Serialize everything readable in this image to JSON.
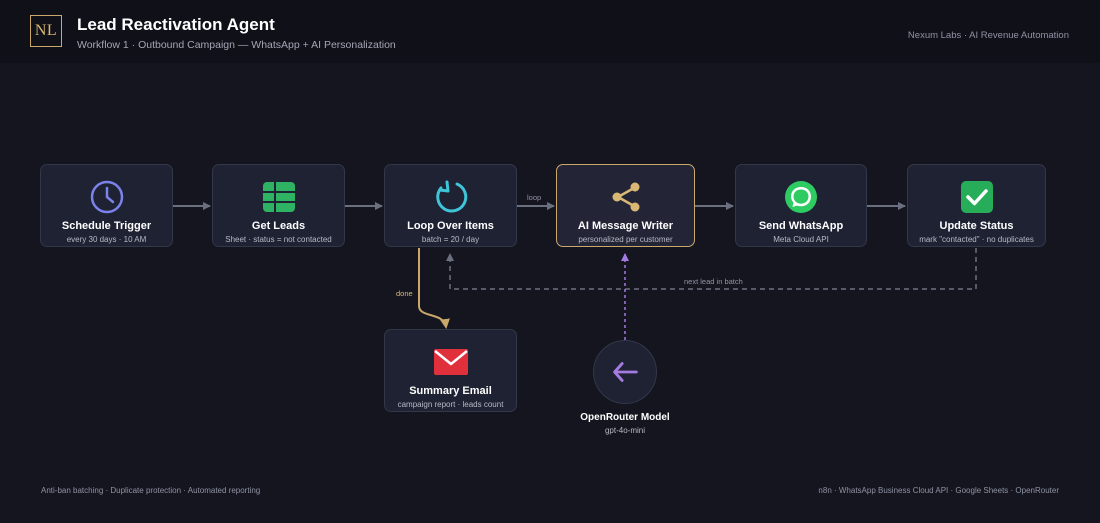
{
  "header": {
    "logo_text": "NL",
    "title": "Lead Reactivation Agent",
    "subtitle": "Workflow 1 · Outbound Campaign — WhatsApp + AI Personalization",
    "brand": "Nexum Labs · AI Revenue Automation"
  },
  "nodes": {
    "schedule": {
      "label": "Schedule Trigger",
      "desc": "every 30 days · 10 AM",
      "icon": "clock-icon",
      "color": "#7b82e8"
    },
    "get_leads": {
      "label": "Get Leads",
      "desc": "Sheet · status = not contacted",
      "icon": "sheet-icon",
      "color": "#2eb364"
    },
    "loop": {
      "label": "Loop Over Items",
      "desc": "batch = 20 / day",
      "icon": "loop-icon",
      "color": "#3fc4d8"
    },
    "ai_writer": {
      "label": "AI Message Writer",
      "desc": "personalized per customer",
      "icon": "share-icon",
      "color": "#d9b874"
    },
    "whatsapp": {
      "label": "Send WhatsApp",
      "desc": "Meta Cloud API",
      "icon": "whatsapp-icon",
      "color": "#2ecb63"
    },
    "update": {
      "label": "Update Status",
      "desc": "mark \"contacted\" · no duplicates",
      "icon": "check-icon",
      "color": "#27ad5a"
    },
    "summary": {
      "label": "Summary Email",
      "desc": "campaign report · leads count",
      "icon": "mail-icon",
      "color": "#e0303c"
    },
    "model": {
      "label": "OpenRouter Model",
      "desc": "gpt-4o-mini",
      "icon": "arrow-left-icon",
      "color": "#a47be0"
    }
  },
  "edges": {
    "loop_label": "loop",
    "done_label": "done",
    "next_lead_label": "next lead in batch"
  },
  "footer": {
    "left": "Anti-ban batching · Duplicate protection · Automated reporting",
    "right": "n8n · WhatsApp Business Cloud API · Google Sheets · OpenRouter"
  },
  "colors": {
    "background": "#14151f",
    "node_fill": "#1e2233",
    "node_border": "#323749",
    "accent_gold": "#c9a86a",
    "connector": "#6b7080",
    "model_link": "#a47be0"
  }
}
